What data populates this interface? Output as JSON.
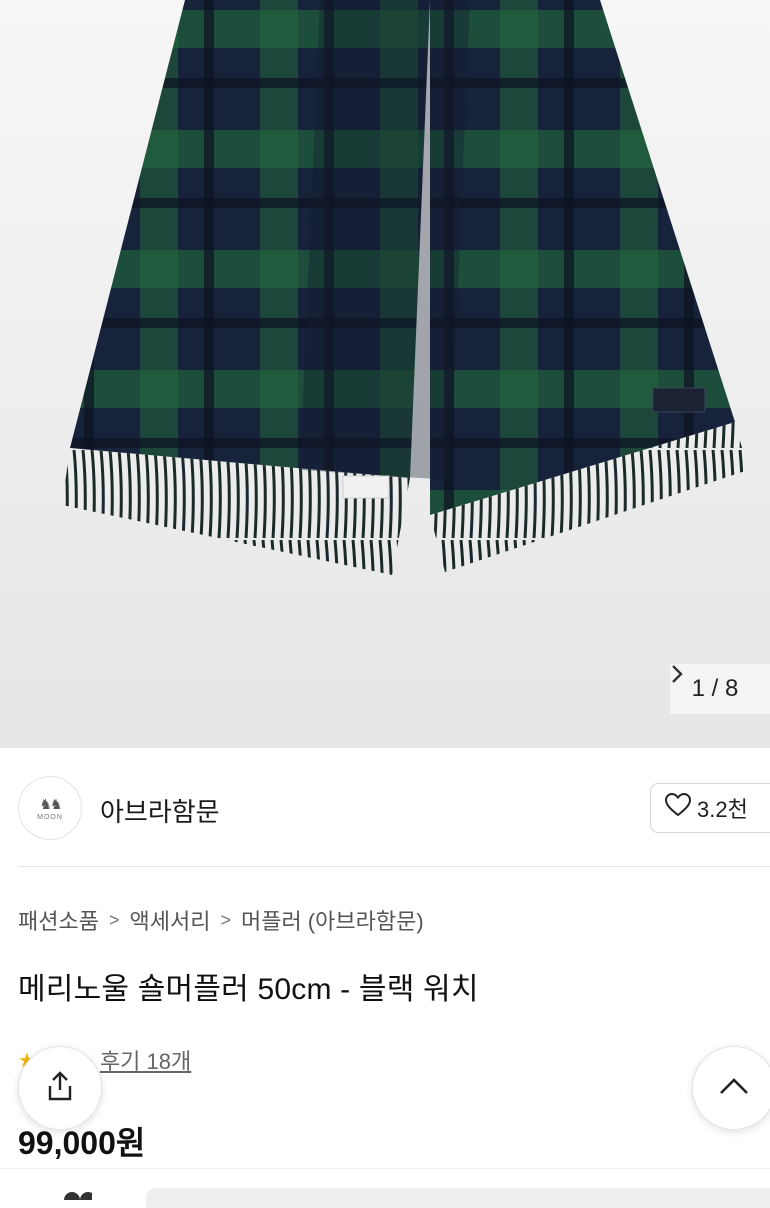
{
  "gallery": {
    "counter": "1 / 8",
    "next_icon": "chevron-right-icon"
  },
  "brand": {
    "name": "아브라함문",
    "logo_text": "MOON",
    "like_count": "3.2천",
    "like_icon": "heart-outline-icon"
  },
  "breadcrumb": [
    "패션소품",
    "액세서리",
    "머플러 (아브라함문)"
  ],
  "product": {
    "title": "메리노울 숄머플러 50cm - 블랙 워치",
    "reviews": "후기 18개",
    "price": "99,000원"
  },
  "colors": {
    "scarf_navy": "#17233a",
    "scarf_green": "#1f5a3b",
    "accent_star": "#f2b300"
  }
}
